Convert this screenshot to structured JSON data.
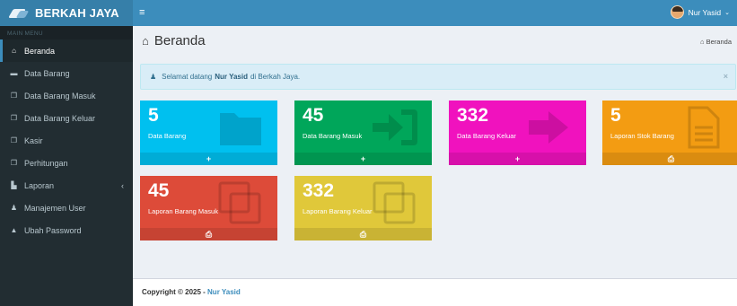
{
  "app": {
    "title": "BERKAH JAYA"
  },
  "header": {
    "menu_toggle": "≡",
    "user_name": "Nur Yasid",
    "user_caret": "⌄"
  },
  "sidebar": {
    "header": "MAIN MENU",
    "items": [
      {
        "label": "Beranda",
        "icon": "home-icon",
        "glyph": "⌂"
      },
      {
        "label": "Data Barang",
        "icon": "folder-icon",
        "glyph": "▬"
      },
      {
        "label": "Data Barang Masuk",
        "icon": "clone-icon",
        "glyph": "❐"
      },
      {
        "label": "Data Barang Keluar",
        "icon": "clone-icon",
        "glyph": "❐"
      },
      {
        "label": "Kasir",
        "icon": "clone-icon",
        "glyph": "❐"
      },
      {
        "label": "Perhitungan",
        "icon": "clone-icon",
        "glyph": "❐"
      },
      {
        "label": "Laporan",
        "icon": "file-icon",
        "glyph": "▙",
        "chevron": "‹"
      },
      {
        "label": "Manajemen User",
        "icon": "user-icon",
        "glyph": "♟"
      },
      {
        "label": "Ubah Password",
        "icon": "lock-icon",
        "glyph": "▲"
      }
    ]
  },
  "page": {
    "title": "Beranda",
    "breadcrumb": "Beranda"
  },
  "alert": {
    "prefix": "Selamat datang",
    "name": "Nur Yasid",
    "suffix": "di Berkah Jaya.",
    "close": "×"
  },
  "boxes": [
    {
      "number": "5",
      "label": "Data Barang",
      "color": "#00c0ef",
      "icon": "folder-icon",
      "footer_icon": "plus-icon",
      "footer": "+"
    },
    {
      "number": "45",
      "label": "Data Barang Masuk",
      "color": "#00a65a",
      "icon": "sign-in-icon",
      "footer_icon": "plus-icon",
      "footer": "+"
    },
    {
      "number": "332",
      "label": "Data Barang Keluar",
      "color": "#f012be",
      "icon": "arrow-right-icon",
      "footer_icon": "plus-icon",
      "footer": "+"
    },
    {
      "number": "5",
      "label": "Laporan Stok Barang",
      "color": "#f39c12",
      "icon": "file-text-icon",
      "footer_icon": "print-icon",
      "footer": "⎙"
    },
    {
      "number": "45",
      "label": "Laporan Barang Masuk",
      "color": "#dd4b39",
      "icon": "clone-icon",
      "footer_icon": "print-icon",
      "footer": "⎙"
    },
    {
      "number": "332",
      "label": "Laporan Barang Keluar",
      "color": "#e0c83a",
      "icon": "clone-icon",
      "footer_icon": "print-icon",
      "footer": "⎙"
    }
  ],
  "footer": {
    "copyright": "Copyright © 2025 -",
    "author": "Nur Yasid"
  },
  "colors": {
    "topbar": "#3c8dbc",
    "logo_bg": "#367fa9",
    "sidebar": "#222d32",
    "content_bg": "#ecf0f5"
  }
}
